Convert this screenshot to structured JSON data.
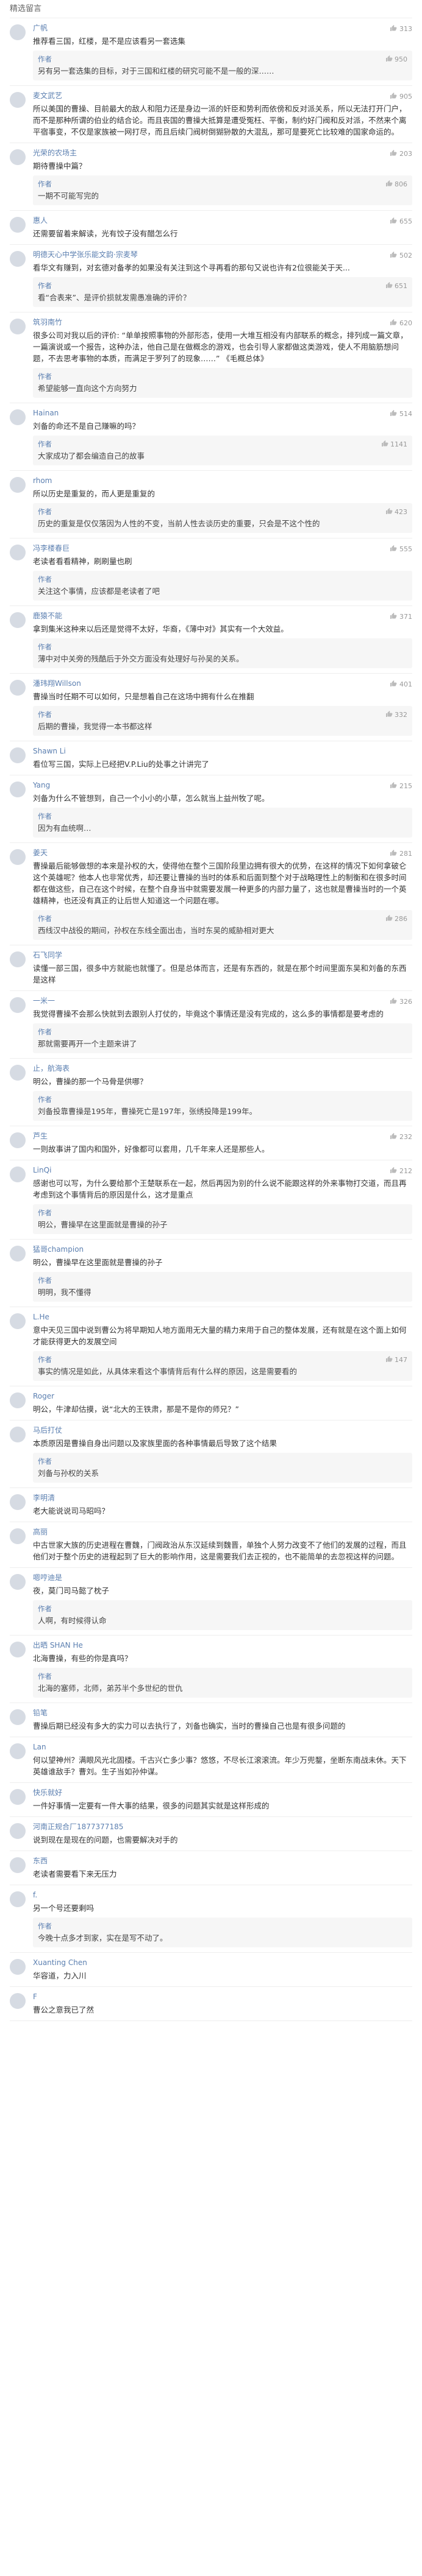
{
  "section_title": "精选留言",
  "comments": [
    {
      "name": "广帆",
      "meta": "",
      "likes": "313",
      "text": "推荐看三国，红楼，是不是应该看另一套选集",
      "reply": {
        "author": "作者",
        "likes": "950",
        "text": "另有另一套选集的目标，对于三国和红楼的研究可能不是一般的深……"
      }
    },
    {
      "name": "麦文武艺",
      "meta": "",
      "likes": "905",
      "text": "所以美国的曹操、目前最大的敌人和阻力还是身边一派的奸臣和势利而依傍和反对派关系，所以无法打开门户，而不是那种所谓的伯业的结合论。而且丧国的曹操大抵算是遭受冤枉、平衡，制约好门阀和反对派，不然来个离平宿事变，不仅是家族被一网打尽，而且后续门阀树倒猢狲散的大混乱，那可是要死亡比较难的国家命运的。",
      "reply": null
    },
    {
      "name": "光荣的农场主",
      "meta": "",
      "likes": "203",
      "text": "期待曹操中篇？",
      "reply": {
        "author": "作者",
        "likes": "806",
        "text": "一期不可能写完的"
      }
    },
    {
      "name": "惠人",
      "meta": "",
      "likes": "655",
      "text": "还需要留着来解读，光有饺子没有醋怎么行",
      "reply": null
    },
    {
      "name": "明德天心中学张乐能文韵·宗麦琴",
      "meta": "",
      "likes": "502",
      "text": "看华文有赚到，对玄德对备孝的如果没有关注到这个寻再看的那句又说也许有2位很能关于天...",
      "reply": {
        "author": "作者",
        "likes": "651",
        "text": "看“合表来”、是评价损就发需愚准确的评价？"
      }
    },
    {
      "name": "筑羽南竹",
      "meta": "",
      "likes": "620",
      "text": "很多公司对我以后的评价: “单单按照事物的外部形态，使用一大堆互相没有内部联系的概念，排列成一篇文章，一篇演说或一个报告，这种办法，他自己是在做概念的游戏，也会引导人家都做这类游戏，使人不用脑筋想问题，不去思考事物的本质，而满足于罗列了的现象……” 《毛概总体》",
      "reply": {
        "author": "作者",
        "likes": "",
        "text": "希望能够一直向这个方向努力"
      }
    },
    {
      "name": "Hainan",
      "meta": "",
      "likes": "514",
      "text": "刘备的命还不是自己赚嘛的吗？",
      "reply": {
        "author": "作者",
        "likes": "1141",
        "text": "大家成功了都会编造自己的故事"
      }
    },
    {
      "name": "rhom",
      "meta": "",
      "likes": "",
      "text": "所以历史是重复的，而人更是重复的",
      "reply": {
        "author": "作者",
        "likes": "423",
        "text": "历史的重复是仅仅落因为人性的不变，当前人性去谈历史的重要，只会是不这个性的"
      }
    },
    {
      "name": "冯李楼春巨",
      "meta": "",
      "likes": "555",
      "text": "老读者看看精神，刷刷量也刷",
      "reply": {
        "author": "作者",
        "likes": "",
        "text": "关注这个事情，应该都是老读者了吧"
      }
    },
    {
      "name": "鹿猿不能",
      "meta": "",
      "likes": "371",
      "text": "拿到集米这种来以后还是觉得不太好，华裔，《薄中对》其实有一个大效益。",
      "reply": {
        "author": "作者",
        "likes": "",
        "text": "薄中对中关旁的残酷后于外交方面没有处理好与孙吴的关系。"
      }
    },
    {
      "name": "潘玮翔Willson",
      "meta": "",
      "likes": "401",
      "text": "曹操当时任期不可以如何，只是想着自己在这场中拥有什么在推翻",
      "reply": {
        "author": "作者",
        "likes": "332",
        "text": "后期的曹操，我觉得一本书都这样"
      }
    },
    {
      "name": "Shawn Li",
      "meta": "",
      "likes": "",
      "text": "看位写三国，实际上已经把V.P.Liu的处事之计讲完了",
      "reply": null
    },
    {
      "name": "Yang",
      "meta": "",
      "likes": "215",
      "text": "刘备为什么不管想到，自己一个小小的小草，怎么就当上益州牧了呢。",
      "reply": {
        "author": "作者",
        "likes": "",
        "text": "因为有血统啊…"
      }
    },
    {
      "name": "姜天",
      "meta": "",
      "likes": "281",
      "text": "曹操最后能够做想的本来是孙权的大，使得他在整个三国阶段里边拥有很大的优势，在这样的情况下如何拿破仑这个英雄呢？他本人也非常优秀，却还要让曹操的当时的体系和后面到整个对于战略理性上的制衡和在很多时间都在做这些，自己在这个时候，在整个自身当中就需要发展一种更多的内部力量了，这也就是曹操当时的一个英雄精神，也还没有真正的让后世人知道这一个问题在哪。",
      "reply": {
        "author": "作者",
        "likes": "286",
        "text": "西线汉中战役的期间，孙权在东线全面出击，当时东吴的威胁相对更大"
      }
    },
    {
      "name": "石飞同学",
      "meta": "",
      "likes": "",
      "text": "读懂一部三国，很多中方就能也就懂了。但是总体而言，还是有东西的，就是在那个时间里面东吴和刘备的东西是这样",
      "reply": null
    },
    {
      "name": "一米一",
      "meta": "",
      "likes": "326",
      "text": "我觉得曹操不会那么快就到去跟别人打仗的，毕竟这个事情还是没有完成的，这么多的事情都是要考虑的",
      "reply": {
        "author": "作者",
        "likes": "",
        "text": "那就需要再开一个主题来讲了"
      }
    },
    {
      "name": "止，航海表",
      "meta": "",
      "likes": "",
      "text": "明公，曹操的那一个马骨是供哪？",
      "reply": {
        "author": "作者",
        "likes": "",
        "text": "刘备投靠曹操是195年，曹操死亡是197年，张绣投降是199年。"
      }
    },
    {
      "name": "芦生",
      "meta": "",
      "likes": "232",
      "text": "一则故事讲了国内和国外，好像都可以套用，几千年来人还是那些人。",
      "reply": null
    },
    {
      "name": "LinQi",
      "meta": "",
      "likes": "212",
      "text": "感谢也可以写，为什么要给那个王楚联系在一起，然后再因为别的什么说不能跟这样的外来事物打交道，而且再考虑到这个事情背后的原因是什么，这才是重点",
      "reply": {
        "author": "作者",
        "likes": "",
        "text": "明公，曹操早在这里面就是曹操的孙子"
      }
    },
    {
      "name": "猛哥champion",
      "meta": "",
      "likes": "",
      "text": "明公，曹操早在这里面就是曹操的孙子",
      "reply": {
        "author": "作者",
        "likes": "",
        "text": "明明，我不懂得"
      }
    },
    {
      "name": "L.He",
      "meta": "",
      "likes": "",
      "text": "意中天见三国中说到曹公为将早期知人地方面用无大量的精力来用于自己的整体发展，还有就是在这个面上如何才能获得更大的发展空间",
      "reply": {
        "author": "作者",
        "likes": "147",
        "text": "事实的情况是如此，从具体来看这个事情背后有什么样的原因，这是需要看的"
      }
    },
    {
      "name": "Roger",
      "meta": "",
      "likes": "",
      "text": "明公，牛津却估摸，说“北大的王铁肃，那是不是你的师兄？”",
      "reply": null
    },
    {
      "name": "马后打仗",
      "meta": "",
      "likes": "",
      "text": "本质原因是曹操自身出问题以及家族里面的各种事情最后导致了这个结果",
      "reply": {
        "author": "作者",
        "likes": "",
        "text": "刘备与孙权的关系"
      }
    },
    {
      "name": "李明清",
      "meta": "",
      "likes": "",
      "text": "老大能说说司马昭吗？",
      "reply": null
    },
    {
      "name": "高丽",
      "meta": "",
      "likes": "",
      "text": "中古世家大族的历史进程在曹魏，门阀政治从东汉延续到魏晋，单独个人努力改变不了他们的发展的过程，而且他们对于整个历史的进程起到了巨大的影响作用，这是需要我们去正视的，也不能简单的去忽视这样的问题。",
      "reply": null
    },
    {
      "name": "嗯哼迪是",
      "meta": "",
      "likes": "",
      "text": "夜，莫门司马懿了枕子",
      "reply": {
        "author": "作者",
        "likes": "",
        "text": "人啊，有时候得认命"
      }
    },
    {
      "name": "出晒 SHAN He",
      "meta": "",
      "likes": "",
      "text": "北海曹操，有些的你是真吗？",
      "reply": {
        "author": "作者",
        "likes": "",
        "text": "北海的塞师，北师，弟苏半个多世纪的世仇"
      }
    },
    {
      "name": "铅笔",
      "meta": "",
      "likes": "",
      "text": "曹操后期已经没有多大的实力可以去执行了，刘备也确实，当时的曹操自己也是有很多问题的",
      "reply": null
    },
    {
      "name": "Lan",
      "meta": "",
      "likes": "",
      "text": "何以望神州？满眼风光北固楼。千古兴亡多少事？悠悠，不尽长江滚滚流。年少万兜鍪，坐断东南战未休。天下英雄谁敌手？曹刘。生子当如孙仲谋。",
      "reply": null
    },
    {
      "name": "快乐就好",
      "meta": "",
      "likes": "",
      "text": "一件好事情一定要有一件大事的结果，很多的问题其实就是这样形成的",
      "reply": null
    },
    {
      "name": "河南正规合厂1877377185",
      "meta": "",
      "likes": "",
      "text": "说到现在是现在的问题，也需要解决对手的",
      "reply": null
    },
    {
      "name": "东西",
      "meta": "",
      "likes": "",
      "text": "老读者需要看下来无压力",
      "reply": null
    },
    {
      "name": "f.",
      "meta": "",
      "likes": "",
      "text": "另一个号还要剩吗",
      "reply": {
        "author": "作者",
        "likes": "",
        "text": "今晚十点多才到家，实在是写不动了。"
      }
    },
    {
      "name": "Xuanting Chen",
      "meta": "",
      "likes": "",
      "text": "华容道，力入川",
      "reply": null
    },
    {
      "name": "F",
      "meta": "",
      "likes": "",
      "text": "曹公之意我已了然",
      "reply": null
    }
  ],
  "icons": {
    "like": "thumbs-up-icon",
    "author_tag": "author-badge"
  }
}
